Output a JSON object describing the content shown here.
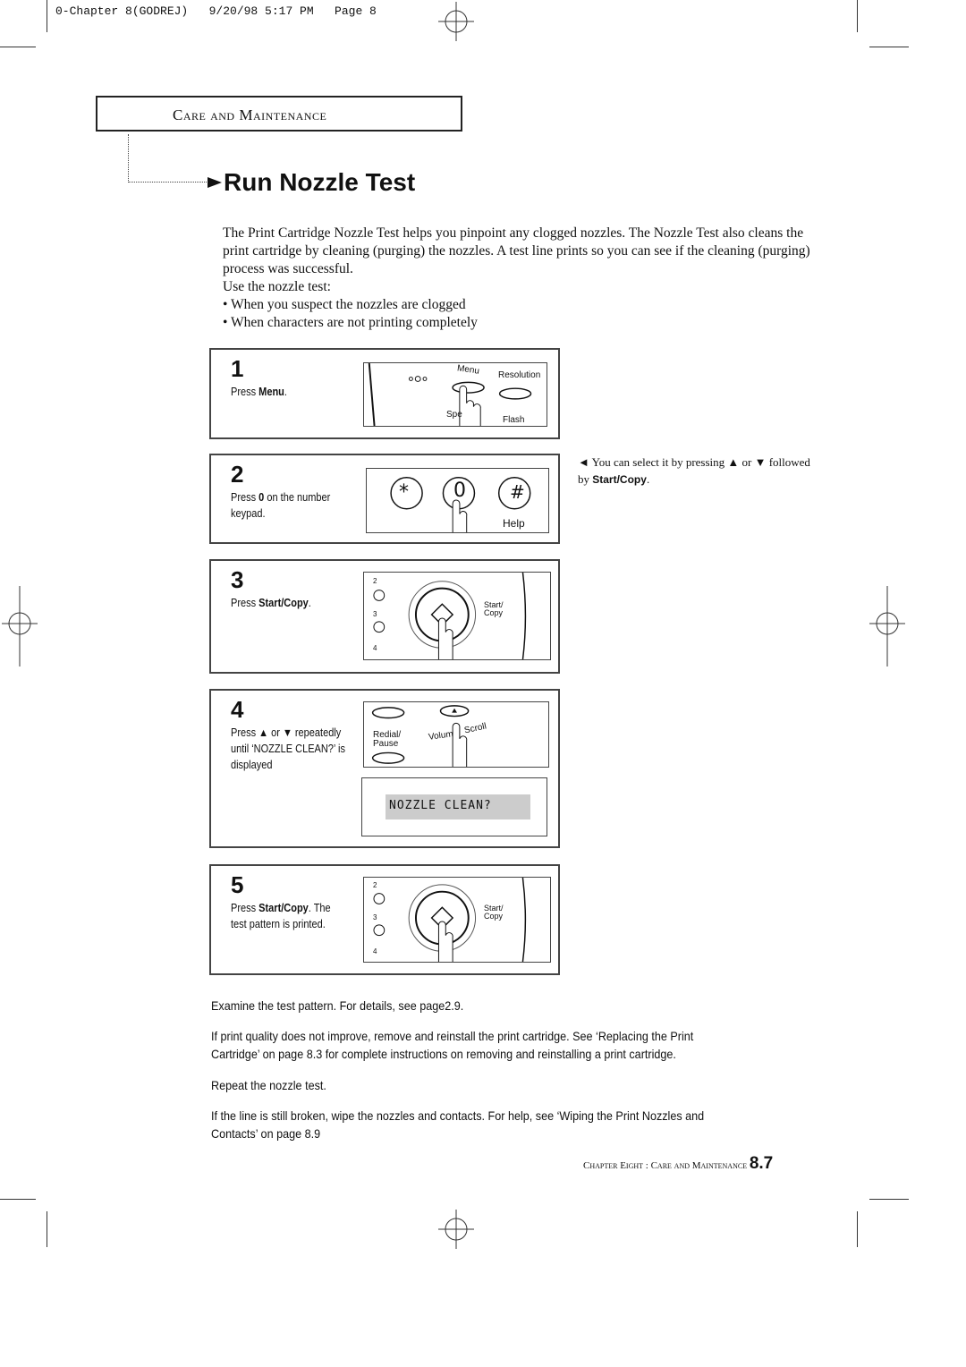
{
  "header": {
    "slug": "0-Chapter 8(GODREJ)   9/20/98 5:17 PM   Page 8"
  },
  "section": {
    "title": "Care and Maintenance"
  },
  "page": {
    "title": "Run Nozzle Test"
  },
  "intro": {
    "paragraph": "The Print Cartridge Nozzle Test helps you pinpoint any clogged nozzles. The Nozzle Test also cleans the print cartridge by cleaning (purging) the nozzles. A test line prints so you can see if the cleaning (purging) process was successful.",
    "use_label": "Use the nozzle test:",
    "bullets": [
      "When you suspect the nozzles are clogged",
      "When characters are not printing completely"
    ]
  },
  "steps": [
    {
      "number": "1",
      "pre": "Press ",
      "bold": "Menu",
      "post": ".",
      "pic": {
        "menu": "Menu",
        "resolution": "Resolution",
        "speed": "Spe",
        "flash": "Flash"
      }
    },
    {
      "number": "2",
      "pre": "Press ",
      "bold": "0",
      "post": " on the number keypad.",
      "pic": {
        "star": "*",
        "zero": "0",
        "hash": "#",
        "help": "Help"
      }
    },
    {
      "number": "3",
      "pre": "Press ",
      "bold": "Start/Copy",
      "post": ".",
      "pic": {
        "k2": "2",
        "k3": "3",
        "k4": "4",
        "start1": "Start/",
        "start2": "Copy"
      }
    },
    {
      "number": "4",
      "pre": "Press ▲ or ▼ repeatedly until ‘NOZZLE CLEAN?’ is displayed",
      "bold": "",
      "post": "",
      "pic": {
        "redial1": "Redial/",
        "redial2": "Pause",
        "volume": "Volum",
        "scroll": "Scroll",
        "lcd": "NOZZLE CLEAN?"
      }
    },
    {
      "number": "5",
      "pre": "Press ",
      "bold": "Start/Copy",
      "post": ". The test pattern is printed.",
      "pic": {
        "k2": "2",
        "k3": "3",
        "k4": "4",
        "start1": "Start/",
        "start2": "Copy"
      }
    }
  ],
  "side_note": {
    "pre": "◄ You can select it by pressing ▲ or ▼ followed by ",
    "bold": "Start/Copy",
    "post": "."
  },
  "body": [
    "Examine the test pattern. For details, see page2.9.",
    "If print quality does not improve, remove and reinstall the print cartridge. See ‘Replacing the Print Cartridge’ on page 8.3 for complete instructions on removing and reinstalling a print cartridge.",
    "Repeat the nozzle test.",
    "If the line is still broken, wipe the nozzles and contacts. For help, see ‘Wiping the Print Nozzles and Contacts’ on page 8.9"
  ],
  "footer": {
    "chapter": "Chapter Eight : Care and Maintenance",
    "page_number": "8.7"
  }
}
